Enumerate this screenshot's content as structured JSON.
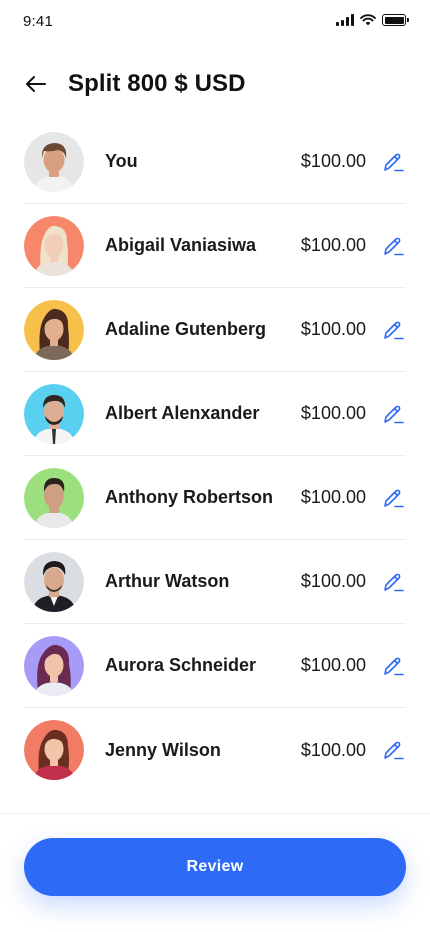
{
  "status_bar": {
    "time": "9:41"
  },
  "header": {
    "title": "Split 800 $ USD"
  },
  "participants": [
    {
      "name": "You",
      "amount": "$100.00",
      "avatar_bg": "#e6e6e6",
      "skin": "#d9a07f",
      "hair": "#6b4a33",
      "shirt": "#f2f2f2"
    },
    {
      "name": "Abigail Vaniasiwa",
      "amount": "$100.00",
      "avatar_bg": "#f6876a",
      "skin": "#f2cdb7",
      "hair": "#f0e2c9",
      "shirt": "#e9e3d9"
    },
    {
      "name": "Adaline Gutenberg",
      "amount": "$100.00",
      "avatar_bg": "#f7c04a",
      "skin": "#e3b08f",
      "hair": "#4a2b1c",
      "shirt": "#7d6a5a"
    },
    {
      "name": "Albert Alenxander",
      "amount": "$100.00",
      "avatar_bg": "#5ad0f0",
      "skin": "#dcae93",
      "hair": "#2e2722",
      "shirt": "#f5f5f5"
    },
    {
      "name": "Anthony Robertson",
      "amount": "$100.00",
      "avatar_bg": "#9be07d",
      "skin": "#cf9f84",
      "hair": "#2b211c",
      "shirt": "#e8e8e8"
    },
    {
      "name": "Arthur Watson",
      "amount": "$100.00",
      "avatar_bg": "#dadde2",
      "skin": "#d8a98d",
      "hair": "#1f1a17",
      "shirt": "#1e1e24"
    },
    {
      "name": "Aurora Schneider",
      "amount": "$100.00",
      "avatar_bg": "#a69cf7",
      "skin": "#f0c3ab",
      "hair": "#6a2a52",
      "shirt": "#ececf5"
    },
    {
      "name": "Jenny Wilson",
      "amount": "$100.00",
      "avatar_bg": "#f27b63",
      "skin": "#f2c4a8",
      "hair": "#6b2f22",
      "shirt": "#c0304a"
    }
  ],
  "footer": {
    "review_label": "Review"
  },
  "colors": {
    "accent": "#2d6bf6",
    "text": "#1a1a1a",
    "divider": "#ececec"
  },
  "icons": {
    "back": "arrow-left-icon",
    "edit": "pencil-icon"
  }
}
